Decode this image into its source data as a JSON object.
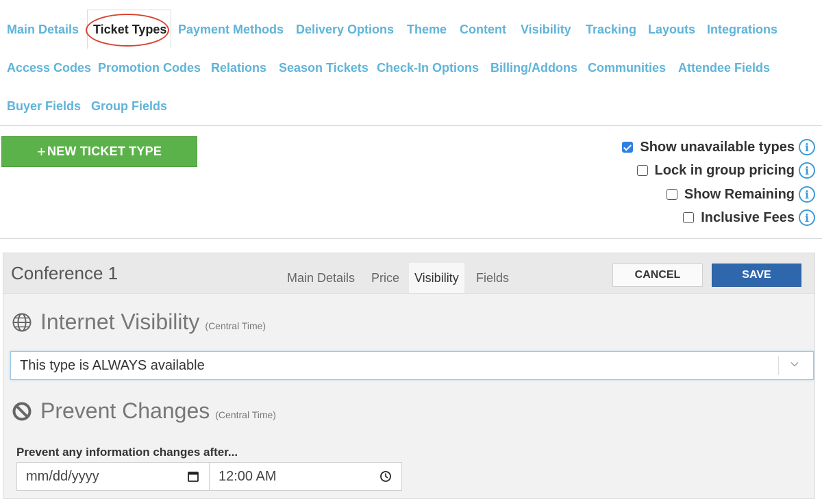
{
  "nav": {
    "row1": [
      "Main Details",
      "Ticket Types",
      "Payment Methods",
      "Delivery Options",
      "Theme",
      "Content",
      "Visibility",
      "Tracking",
      "Layouts",
      "Integrations"
    ],
    "row2": [
      "Access Codes",
      "Promotion Codes",
      "Relations",
      "Season Tickets",
      "Check-In Options",
      "Billing/Addons",
      "Communities",
      "Attendee Fields"
    ],
    "row3": [
      "Buyer Fields",
      "Group Fields"
    ],
    "active": "Ticket Types"
  },
  "toolbar": {
    "new_button_icon": "+",
    "new_button_label": "NEW TICKET TYPE",
    "options": [
      {
        "label": "Show unavailable types",
        "checked": true
      },
      {
        "label": "Lock in group pricing",
        "checked": false
      },
      {
        "label": "Show Remaining",
        "checked": false
      },
      {
        "label": "Inclusive Fees",
        "checked": false
      }
    ],
    "info_icon_glyph": "i"
  },
  "editor": {
    "title": "Conference 1",
    "tabs": [
      "Main Details",
      "Price",
      "Visibility",
      "Fields"
    ],
    "active_tab": "Visibility",
    "cancel_label": "CANCEL",
    "save_label": "SAVE",
    "internet_visibility": {
      "heading": "Internet Visibility",
      "timezone": "(Central Time)",
      "icon": "globe-icon",
      "selected": "This type is ALWAYS available"
    },
    "prevent_changes": {
      "heading": "Prevent Changes",
      "timezone": "(Central Time)",
      "icon": "ban-icon",
      "field_label": "Prevent any information changes after...",
      "date_placeholder": "mm/dd/yyyy",
      "time_value": "12:00 AM"
    }
  },
  "colors": {
    "link": "#5fb4d9",
    "new_button": "#5cb24a",
    "save_button": "#2f67ad",
    "highlight_ring": "#d9442f",
    "checkbox_checked": "#2f7ee0"
  }
}
